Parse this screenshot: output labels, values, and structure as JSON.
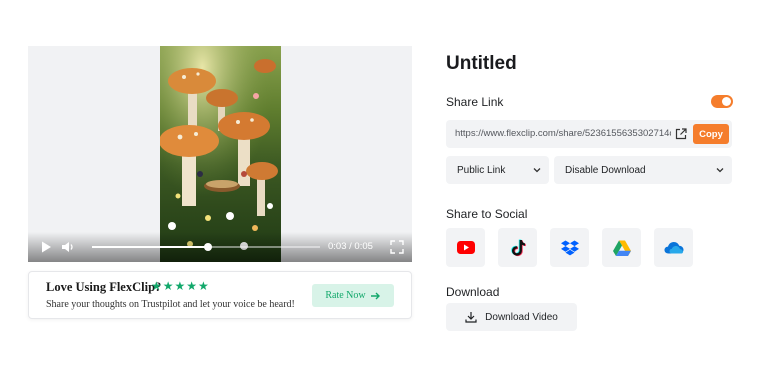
{
  "player": {
    "time_display": "0:03 / 0:05",
    "progress_fraction": 0.51
  },
  "rating_card": {
    "title": "Love Using FlexClip?",
    "stars": "★★★★★",
    "subtitle": "Share your thoughts on Trustpilot and let your voice be heard!",
    "button_label": "Rate Now"
  },
  "panel": {
    "title": "Untitled",
    "share_link_label": "Share Link",
    "share_link_enabled": true,
    "link_url": "https://www.flexclip.com/share/5236155635302714c...",
    "copy_label": "Copy",
    "access_select": "Public Link",
    "download_select": "Disable Download",
    "share_social_label": "Share to Social",
    "socials": [
      {
        "name": "youtube-icon",
        "color": "#ff0000"
      },
      {
        "name": "tiktok-icon",
        "color": "#111111"
      },
      {
        "name": "dropbox-icon",
        "color": "#0061fe"
      },
      {
        "name": "google-drive-icon",
        "color": "#1fa463"
      },
      {
        "name": "onedrive-icon",
        "color": "#0a74d9"
      }
    ],
    "download_label": "Download",
    "download_button": "Download Video"
  },
  "colors": {
    "accent": "#f57d2c",
    "rating_green": "#12a86b"
  }
}
